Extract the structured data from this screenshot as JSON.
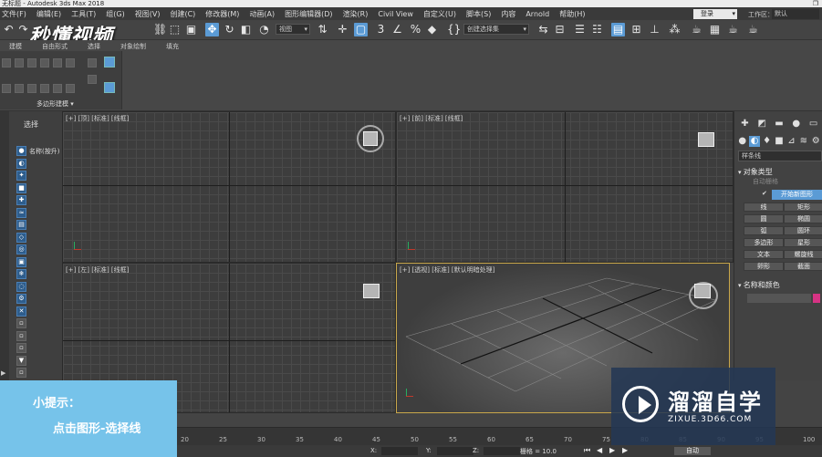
{
  "title_bar": {
    "text": "无标题 - Autodesk 3ds Max 2018",
    "window_button": "❐"
  },
  "menu": [
    "文件(F)",
    "编辑(E)",
    "工具(T)",
    "组(G)",
    "视图(V)",
    "创建(C)",
    "修改器(M)",
    "动画(A)",
    "图形编辑器(D)",
    "渲染(R)",
    "Civil View",
    "自定义(U)",
    "脚本(S)",
    "内容",
    "Arnold",
    "帮助(H)"
  ],
  "login": {
    "value": "登录"
  },
  "workspace": {
    "label": "工作区：",
    "value": "默认"
  },
  "toolbar": {
    "view_dropdown": "视图",
    "selection_set": "创建选择集"
  },
  "logo": {
    "text": "秒懂视频"
  },
  "ribbon": {
    "tabs": [
      "建模",
      "自由形式",
      "选择",
      "对象绘制",
      "填充"
    ],
    "caption": "多边形建模 ▾"
  },
  "left_panel": {
    "title": "选择",
    "name_header": "名称(按升)"
  },
  "viewports": {
    "top": "[+] [顶] [标准] [线框]",
    "front": "[+] [前] [标准] [线框]",
    "left": "[+] [左] [标准] [线框]",
    "persp": "[+] [透视] [标准] [默认明暗处理]"
  },
  "command_panel": {
    "dropdown": "样条线",
    "object_type": "对象类型",
    "auto_grid": "自动栅格",
    "start_new_shape": "开始新图形",
    "buttons": [
      "线",
      "矩形",
      "圆",
      "椭圆",
      "弧",
      "圆环",
      "多边形",
      "星形",
      "文本",
      "螺旋线",
      "卵形",
      "截面"
    ],
    "name_color": "名称和颜色",
    "color": "#d63384"
  },
  "timeline": {
    "ticks": [
      "20",
      "25",
      "30",
      "35",
      "40",
      "45",
      "50",
      "55",
      "60",
      "65",
      "70",
      "75",
      "80",
      "85",
      "90",
      "95",
      "100"
    ]
  },
  "status": {
    "x_label": "X:",
    "y_label": "Y:",
    "z_label": "Z:",
    "grid": "栅格 = 10.0",
    "auto": "自动"
  },
  "tip": {
    "title": "小提示：",
    "body": "点击图形-选择线"
  },
  "watermark": {
    "title": "溜溜自学",
    "url": "ZIXUE.3D66.COM"
  }
}
